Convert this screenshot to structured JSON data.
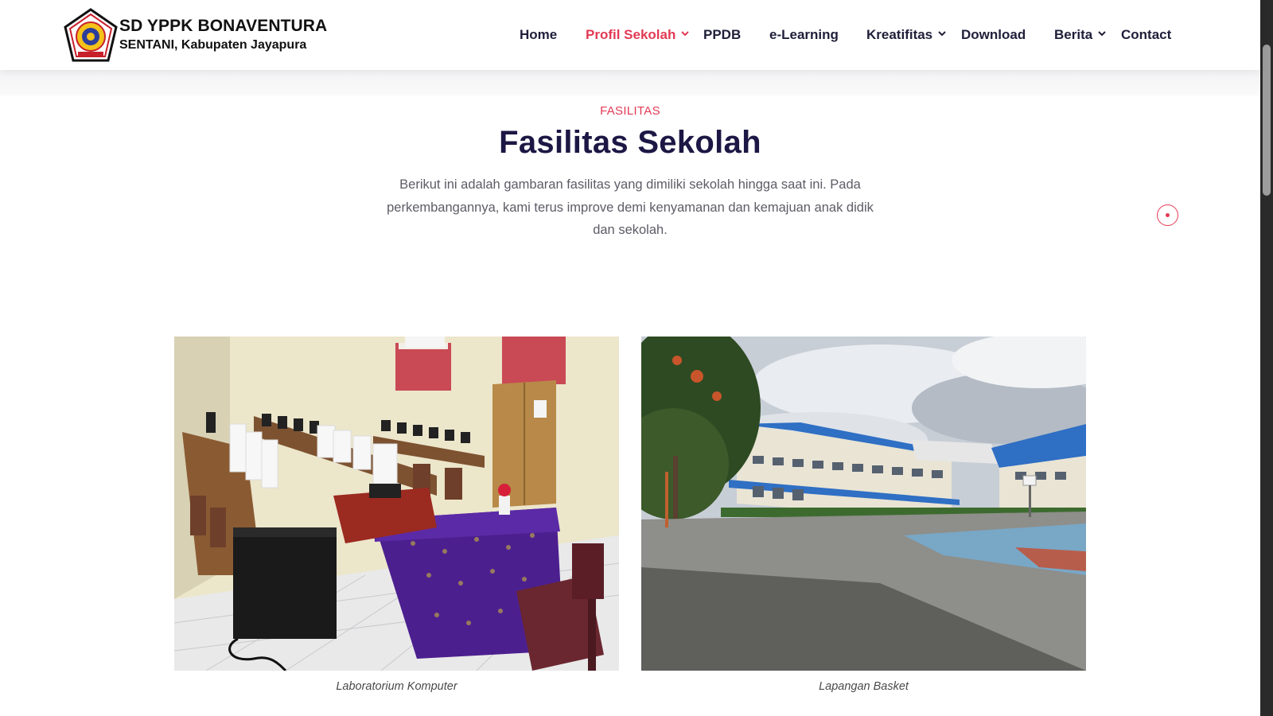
{
  "brand": {
    "title": "SD YPPK BONAVENTURA",
    "subtitle": "SENTANI, Kabupaten Jayapura",
    "logo_icon": "school-crest-logo"
  },
  "nav": {
    "items": [
      {
        "label": "Home",
        "active": false,
        "has_dropdown": false
      },
      {
        "label": "Profil Sekolah",
        "active": true,
        "has_dropdown": true
      },
      {
        "label": "PPDB",
        "active": false,
        "has_dropdown": false
      },
      {
        "label": "e-Learning",
        "active": false,
        "has_dropdown": false
      },
      {
        "label": "Kreatifitas",
        "active": false,
        "has_dropdown": true
      },
      {
        "label": "Download",
        "active": false,
        "has_dropdown": false
      },
      {
        "label": "Berita",
        "active": false,
        "has_dropdown": true
      },
      {
        "label": "Contact",
        "active": false,
        "has_dropdown": false
      }
    ]
  },
  "section": {
    "eyebrow": "FASILITAS",
    "title": "Fasilitas Sekolah",
    "description": "Berikut ini adalah gambaran fasilitas yang dimiliki sekolah hingga saat ini. Pada perkembangannya, kami terus improve demi kenyamanan dan kemajuan anak didik dan sekolah."
  },
  "gallery": [
    {
      "caption": "Laboratorium Komputer",
      "image": "computer-lab-photo"
    },
    {
      "caption": "Lapangan Basket",
      "image": "basketball-court-photo"
    }
  ],
  "colors": {
    "accent": "#e23a55",
    "heading": "#1c1744",
    "text": "#5c5c66"
  }
}
